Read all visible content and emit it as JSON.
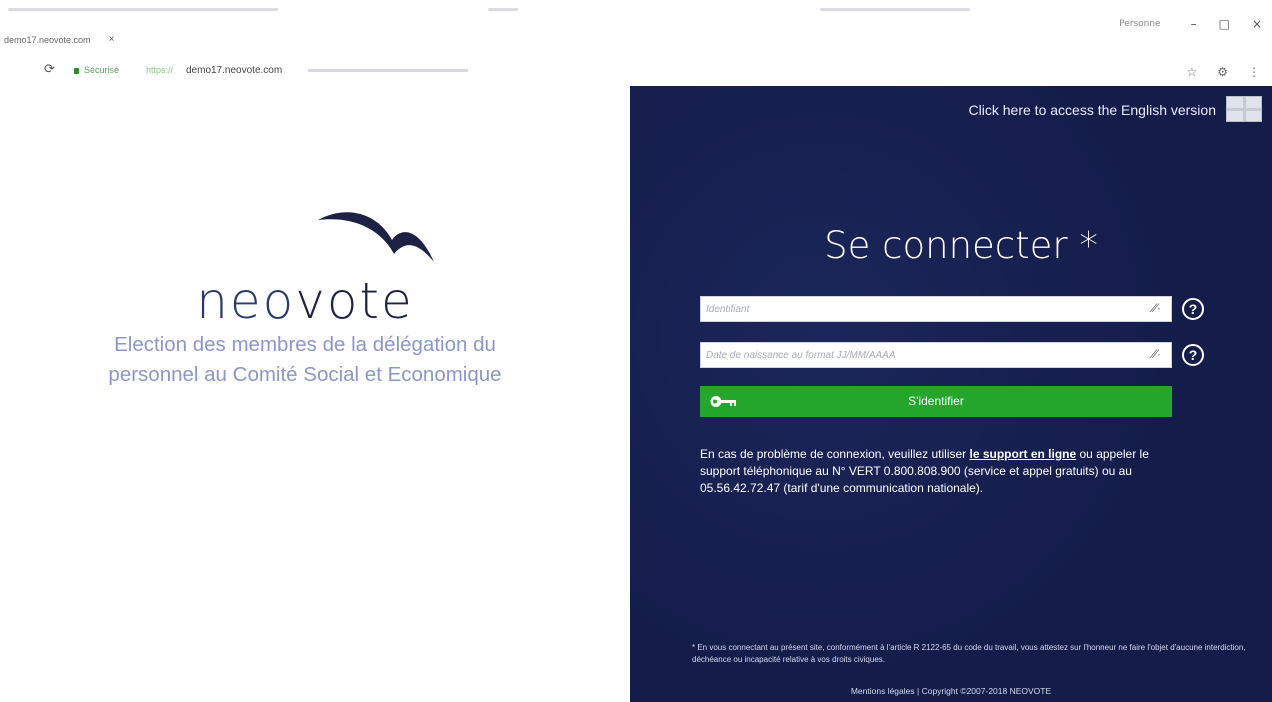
{
  "browser": {
    "tab_title": "demo17.neovote.com",
    "tab_close": "×",
    "secure_label": "Sécurisé",
    "protocol": "https://",
    "url": "demo17.neovote.com",
    "profile_label": "Personne",
    "minimize": "–",
    "maximize": "□",
    "close": "×",
    "reload_icon": "reload-icon",
    "bookmark_icon": "star-icon",
    "extension_icon": "gear-icon",
    "menu_icon": "more-vert-icon"
  },
  "brand": {
    "logo_prefix": "neo",
    "logo_suffix": "vote",
    "election_line1": "Election des membres de la délégation du",
    "election_line2": "personnel au Comité Social et Economique"
  },
  "login": {
    "english_link": "Click here to access the English version",
    "title": "Se connecter *",
    "identifier_placeholder": "Identifiant",
    "birthdate_placeholder": "Date de naissance au format JJ/MM/AAAA",
    "submit_label": "S'identifier",
    "help_glyph": "?",
    "eye_glyph": "⁄⁄·",
    "help_text_before": "En cas de problème de connexion, veuillez utiliser ",
    "help_link": "le support en ligne",
    "help_text_after": " ou appeler le support téléphonique au N° VERT 0.800.808.900 (service et appel gratuits) ou au 05.56.42.72.47 (tarif d'une communication nationale).",
    "legal_note": "* En vous connectant au présent site, conformément à l'article R 2122-65 du code du travail, vous attestez sur l'honneur ne faire l'objet d'aucune interdiction, déchéance ou incapacité relative à vos droits civiques.",
    "footer_legal": "Mentions légales",
    "footer_sep": " | ",
    "footer_copyright": "Copyright ©2007-2018 NEOVOTE"
  },
  "colors": {
    "panel_bg": "#141d4a",
    "button_green": "#23a62b",
    "logo_navy": "#1d2244",
    "subtitle_blue": "#8b97c9"
  }
}
